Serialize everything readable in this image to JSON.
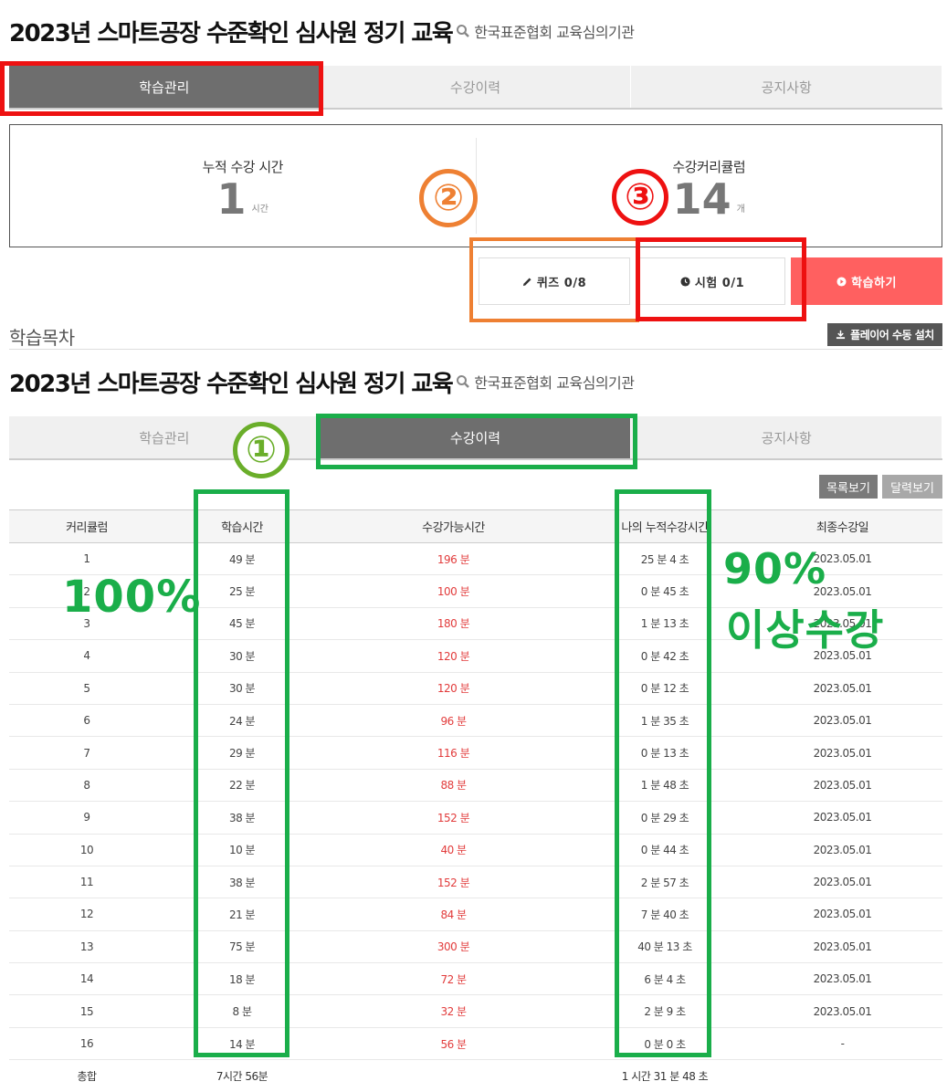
{
  "header1": {
    "title": "2023년 스마트공장 수준확인 심사원 정기 교육",
    "org": "한국표준협회 교육심의기관"
  },
  "tabs1": [
    {
      "label": "학습관리"
    },
    {
      "label": "수강이력"
    },
    {
      "label": "공지사항"
    }
  ],
  "stats": {
    "cumulative": {
      "label": "누적 수강 시간",
      "value": "1",
      "unit": "시간"
    },
    "curriculum": {
      "label": "수강커리큘럼",
      "value": "14",
      "unit": "개"
    }
  },
  "actions": {
    "quiz": "퀴즈 0/8",
    "exam": "시험 0/1",
    "study": "학습하기"
  },
  "toc": {
    "title": "학습목차",
    "install": "플레이어 수동 설치"
  },
  "header2": {
    "title": "2023년 스마트공장 수준확인 심사원 정기 교육",
    "org": "한국표준협회 교육심의기관"
  },
  "tabs2": [
    {
      "label": "학습관리"
    },
    {
      "label": "수강이력"
    },
    {
      "label": "공지사항"
    }
  ],
  "view": {
    "list": "목록보기",
    "calendar": "달력보기"
  },
  "table": {
    "headers": [
      "커리큘럼",
      "학습시간",
      "수강가능시간",
      "나의 누적수강시간",
      "최종수강일"
    ],
    "rows": [
      [
        "1",
        "49 분",
        "196 분",
        "25 분 4 초",
        "2023.05.01"
      ],
      [
        "2",
        "25 분",
        "100 분",
        "0 분 45 초",
        "2023.05.01"
      ],
      [
        "3",
        "45 분",
        "180 분",
        "1 분 13 초",
        "2023.05.01"
      ],
      [
        "4",
        "30 분",
        "120 분",
        "0 분 42 초",
        "2023.05.01"
      ],
      [
        "5",
        "30 분",
        "120 분",
        "0 분 12 초",
        "2023.05.01"
      ],
      [
        "6",
        "24 분",
        "96 분",
        "1 분 35 초",
        "2023.05.01"
      ],
      [
        "7",
        "29 분",
        "116 분",
        "0 분 13 초",
        "2023.05.01"
      ],
      [
        "8",
        "22 분",
        "88 분",
        "1 분 48 초",
        "2023.05.01"
      ],
      [
        "9",
        "38 분",
        "152 분",
        "0 분 29 초",
        "2023.05.01"
      ],
      [
        "10",
        "10 분",
        "40 분",
        "0 분 44 초",
        "2023.05.01"
      ],
      [
        "11",
        "38 분",
        "152 분",
        "2 분 57 초",
        "2023.05.01"
      ],
      [
        "12",
        "21 분",
        "84 분",
        "7 분 40 초",
        "2023.05.01"
      ],
      [
        "13",
        "75 분",
        "300 분",
        "40 분 13 초",
        "2023.05.01"
      ],
      [
        "14",
        "18 분",
        "72 분",
        "6 분 4 초",
        "2023.05.01"
      ],
      [
        "15",
        "8 분",
        "32 분",
        "2 분 9 초",
        "2023.05.01"
      ],
      [
        "16",
        "14 분",
        "56 분",
        "0 분 0 초",
        "-"
      ]
    ],
    "total": [
      "총합",
      "7시간 56분",
      "",
      "1 시간 31 분 48 초",
      ""
    ]
  },
  "annotations": {
    "circle1": "①",
    "circle2": "②",
    "circle3": "③",
    "pct100": "100%",
    "pct90": "90%",
    "above": "이상수강"
  },
  "colors": {
    "active_tab": "#6e6e6e",
    "study_button": "#ff6060",
    "available_time": "#e23c3c",
    "highlight_red": "#ee1111",
    "highlight_orange": "#ee8033",
    "highlight_green": "#1aae4a"
  }
}
